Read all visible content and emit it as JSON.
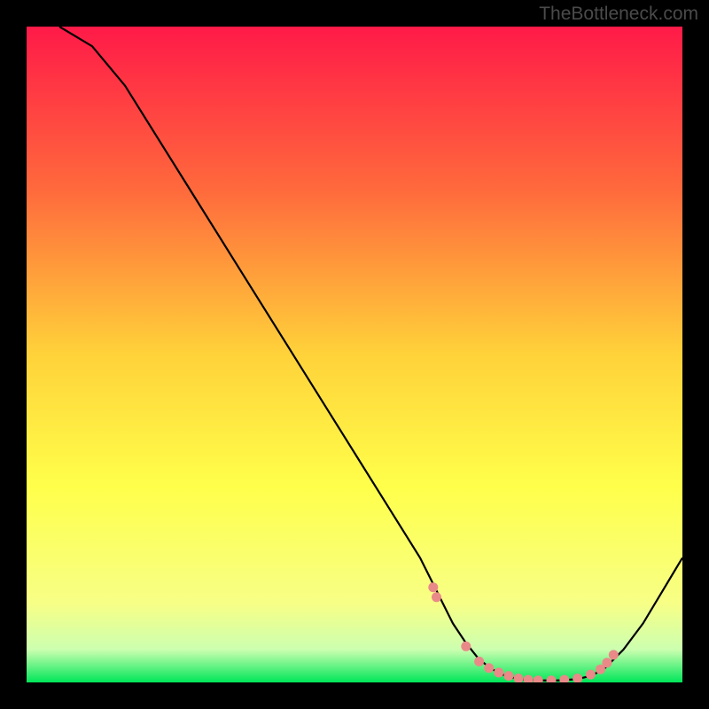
{
  "watermark": "TheBottleneck.com",
  "chart_data": {
    "type": "line",
    "title": "",
    "xlabel": "",
    "ylabel": "",
    "xlim": [
      0,
      100
    ],
    "ylim": [
      0,
      100
    ],
    "background_gradient": {
      "stops": [
        {
          "offset": 0,
          "color": "#ff1a48"
        },
        {
          "offset": 25,
          "color": "#ff6a3c"
        },
        {
          "offset": 50,
          "color": "#ffd23a"
        },
        {
          "offset": 70,
          "color": "#ffff4a"
        },
        {
          "offset": 88,
          "color": "#f7ff86"
        },
        {
          "offset": 95,
          "color": "#ccffb0"
        },
        {
          "offset": 100,
          "color": "#00e659"
        }
      ]
    },
    "series": [
      {
        "name": "bottleneck-curve",
        "color": "#000000",
        "x": [
          5,
          10,
          15,
          20,
          25,
          30,
          35,
          40,
          45,
          50,
          55,
          60,
          62,
          65,
          67,
          69,
          71,
          73,
          75,
          78,
          81,
          84,
          86,
          88,
          91,
          94,
          97,
          100
        ],
        "y": [
          100,
          97,
          91,
          83,
          75,
          67,
          59,
          51,
          43,
          35,
          27,
          19,
          15,
          9,
          6,
          3.5,
          2,
          1,
          0.5,
          0.3,
          0.3,
          0.5,
          1,
          2,
          5,
          9,
          14,
          19
        ]
      }
    ],
    "highlight_points": {
      "name": "minimum-region",
      "color": "#e98a88",
      "x": [
        62,
        62.5,
        67,
        69,
        70.5,
        72,
        73.5,
        75,
        76.5,
        78,
        80,
        82,
        84,
        86,
        87.5,
        88.5,
        89.5
      ],
      "y": [
        14.5,
        13,
        5.5,
        3.2,
        2.2,
        1.5,
        1,
        0.6,
        0.4,
        0.3,
        0.3,
        0.4,
        0.6,
        1.2,
        2,
        3,
        4.2
      ]
    }
  }
}
